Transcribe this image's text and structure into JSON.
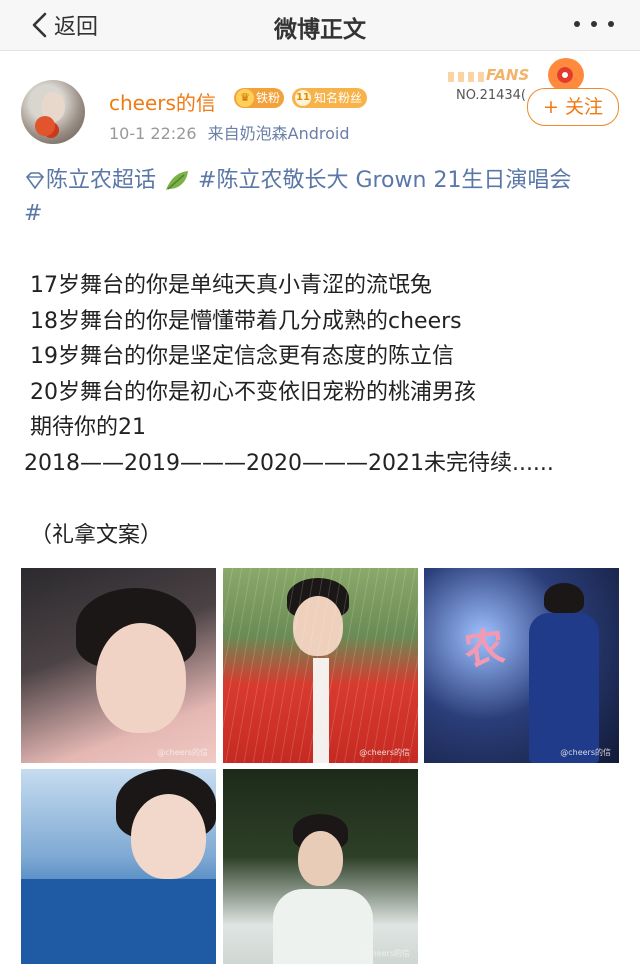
{
  "nav": {
    "back_label": "返回",
    "title": "微博正文"
  },
  "post": {
    "username": "cheers的信",
    "badge_iron": "铁粉",
    "badge_fan_num": "11",
    "badge_fan": "知名粉丝",
    "time": "10-1 22:26",
    "source_prefix": "来自",
    "source": "奶泡森Android",
    "fans_card": {
      "word": "FANS",
      "number": "NO.21434("
    },
    "follow_label": "+ 关注",
    "topic_1": "陈立农超话",
    "topic_2": "#陈立农敬长大 Grown 21生日演唱会",
    "topic_2_end": "#",
    "lines": [
      "17岁舞台的你是单纯天真小青涩的流氓兔",
      "18岁舞台的你是懵懂带着几分成熟的cheers",
      "19岁舞台的你是坚定信念更有态度的陈立信",
      "20岁舞台的你是初心不变依旧宠粉的桃浦男孩",
      "期待你的21",
      "2018——2019———2020———2021未完待续......"
    ],
    "credit": "（礼拿文案）",
    "photo_watermark": "@cheers的信",
    "photo_3_sign": "农"
  },
  "colors": {
    "accent": "#f07a13",
    "link": "#5a77a8"
  }
}
